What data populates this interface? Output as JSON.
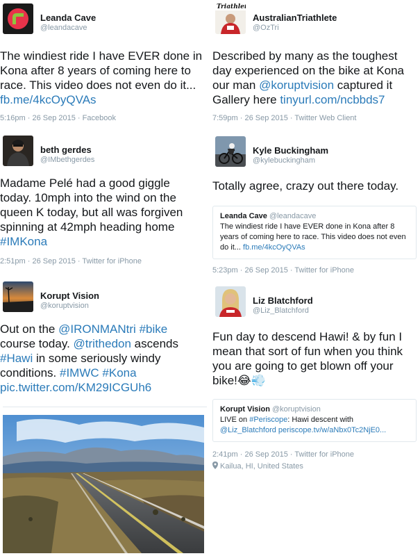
{
  "left": [
    {
      "name": "Leanda Cave",
      "handle": "@leandacave",
      "text_before": "The windiest ride I have EVER done in Kona after 8 years of coming here to race. This video does not even do it... ",
      "link": "fb.me/4kcOyQVAs",
      "meta": "5:16pm · 26 Sep 2015 · Facebook"
    },
    {
      "name": "beth gerdes",
      "handle": "@IMbethgerdes",
      "text_before": "Madame Pelé had a good giggle today. 10mph into the wind on the queen K today, but all was forgiven spinning at 42mph heading home ",
      "link": "#IMKona",
      "meta": "2:51pm · 26 Sep 2015 · Twitter for iPhone"
    },
    {
      "name": "Korupt Vision",
      "handle": "@koruptvision",
      "segments": [
        {
          "t": "Out on the ",
          "link": false
        },
        {
          "t": "@IRONMANtri",
          "link": true
        },
        {
          "t": " ",
          "link": false
        },
        {
          "t": "#bike",
          "link": true
        },
        {
          "t": " course today. ",
          "link": false
        },
        {
          "t": "@trithedon",
          "link": true
        },
        {
          "t": " ascends ",
          "link": false
        },
        {
          "t": "#Hawi",
          "link": true
        },
        {
          "t": " in some seriously windy conditions. ",
          "link": false
        },
        {
          "t": "#IMWC",
          "link": true
        },
        {
          "t": " ",
          "link": false
        },
        {
          "t": "#Kona",
          "link": true
        },
        {
          "t": " ",
          "link": false
        },
        {
          "t": "pic.twitter.com/KM29ICGUh6",
          "link": true
        }
      ]
    }
  ],
  "right": [
    {
      "name": "AustralianTriathlete",
      "handle": "@OzTri",
      "avatar_text": "Triathlete",
      "text_before": "Described by many as the toughest day experienced on the bike at Kona our man ",
      "mention": "@koruptvision",
      "text_mid": " captured it Gallery here ",
      "link": "tinyurl.com/ncbbds7",
      "meta": "7:59pm · 26 Sep 2015 · Twitter Web Client"
    },
    {
      "name": "Kyle Buckingham",
      "handle": "@kylebuckingham",
      "text": "Totally agree, crazy out there today.",
      "quote": {
        "name": "Leanda Cave",
        "handle": "@leandacave",
        "text": "The windiest ride I have EVER done in Kona after 8 years of coming here to race. This video does not even do it... ",
        "link": "fb.me/4kcOyQVAs"
      },
      "meta": "5:23pm · 26 Sep 2015 · Twitter for iPhone"
    },
    {
      "name": "Liz Blatchford",
      "handle": "@Liz_Blatchford",
      "text": "Fun day to descend Hawi! & by fun I mean that sort of fun when you think you are going to get blown off your bike!😂💨",
      "quote": {
        "name": "Korupt Vision",
        "handle": "@koruptvision",
        "text_before": "LIVE on ",
        "hashtag": "#Periscope",
        "text_mid": ": Hawi descent with ",
        "link": "@Liz_Blatchford periscope.tv/w/aNbx0Tc2NjE0..."
      },
      "meta": "2:41pm · 26 Sep 2015 · Twitter for iPhone",
      "location": "Kailua, HI, United States"
    }
  ]
}
